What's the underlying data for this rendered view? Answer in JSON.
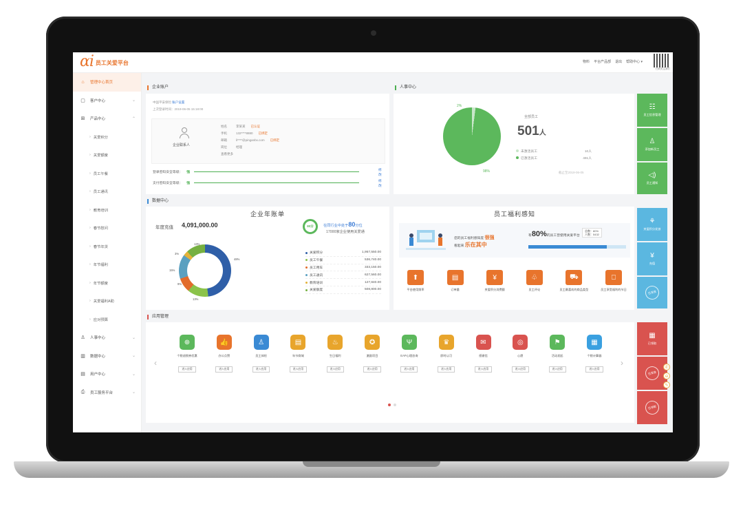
{
  "app": {
    "logo_mark": "αi",
    "logo_text": "员工关爱平台"
  },
  "topbar": {
    "links": [
      "物料",
      "平台产品部",
      "退出",
      "帮助中心 ▾"
    ],
    "qr_caption": "扫码关注我们"
  },
  "sidebar": {
    "items": [
      {
        "label": "管理中心首页",
        "icon": "⌂",
        "active": true
      },
      {
        "label": "客户中心",
        "icon": "▢",
        "chevron": "⌄"
      },
      {
        "label": "产品中心",
        "icon": "⊞",
        "chevron": "⌃"
      }
    ],
    "sub_items": [
      "关爱积分",
      "关爱额度",
      "员工午餐",
      "员工通讯",
      "教育培训",
      "春节慰问",
      "春节年货",
      "年节福利",
      "年节额度",
      "关爱福利A助",
      "应对预算"
    ],
    "bottom_items": [
      {
        "label": "人事中心",
        "icon": "♙",
        "chevron": "⌄"
      },
      {
        "label": "数据中心",
        "icon": "▥",
        "chevron": "⌄"
      },
      {
        "label": "用户中心",
        "icon": "▤",
        "chevron": "⌄"
      },
      {
        "label": "员工服务平台",
        "icon": "⎙",
        "chevron": "⌄"
      }
    ]
  },
  "account": {
    "section_title": "企业账户",
    "meta1": "中国平安保险",
    "meta1_link": "账户设置",
    "meta2": "上次登录时间：2019-06-05 15:18:00",
    "contact_label": "企业联系人",
    "rows": [
      {
        "k": "姓名",
        "v": "李某某",
        "tag": "已认证"
      },
      {
        "k": "手机",
        "v": "132****8880",
        "tag": "已绑定"
      },
      {
        "k": "邮箱",
        "v": "li****@pinganbx.com",
        "tag": "已绑定"
      },
      {
        "k": "岗位",
        "v": "经理",
        "tag": ""
      }
    ],
    "more_link": "查看更多",
    "security": [
      {
        "label": "登录密码安全等级：",
        "level": "强",
        "edit": "修改"
      },
      {
        "label": "支付密码安全等级：",
        "level": "强",
        "edit": "修改"
      }
    ]
  },
  "hr": {
    "section_title": "人事中心",
    "pie_small_label": "2%",
    "pie_large_label": "98%",
    "pie_share_inactive": 0.02,
    "total_label": "全部员工",
    "total_value": "501",
    "total_unit": "人",
    "legend": [
      {
        "label": "未激活员工",
        "value": "10人",
        "color": "#c8e6c9"
      },
      {
        "label": "已激活员工",
        "value": "491人",
        "color": "#5cb85c"
      }
    ],
    "note": "截止至2019-06-05"
  },
  "right_tiles": [
    {
      "label": "员工信息管理",
      "icon": "☷",
      "color": "green"
    },
    {
      "label": "添加新员工",
      "icon": "♙",
      "color": "green"
    },
    {
      "label": "员工通知",
      "icon": "◁)",
      "color": "green"
    },
    {
      "label": "关爱积分发放",
      "icon": "⚘",
      "color": "blue"
    },
    {
      "label": "充值",
      "icon": "¥",
      "color": "blue"
    },
    {
      "label": "已发放",
      "icon": "◎",
      "color": "blue"
    },
    {
      "label": "已领取",
      "icon": "▦",
      "color": "red"
    },
    {
      "label": "已发放",
      "icon": "◎",
      "color": "red"
    },
    {
      "label": "已领取",
      "icon": "◎",
      "color": "red"
    }
  ],
  "data_center": {
    "section_title": "数据中心",
    "bill_title": "企业年账单",
    "annual_label": "年度充值",
    "annual_value": "4,091,000.00",
    "score_badge": "80分",
    "score_text_pre": "在同行业中处于",
    "score_value": "80",
    "score_text_post": "分位",
    "score_sub": "17000家企业使用关爱通",
    "donut_labels": [
      "13%",
      "3%",
      "15%",
      "9%",
      "13%",
      "48%"
    ],
    "bill_items": [
      {
        "name": "关爱积分",
        "value": "1,957,550.00",
        "color": "#2f5fa8"
      },
      {
        "name": "员工午餐",
        "value": "536,740.00",
        "color": "#8bc34a"
      },
      {
        "name": "员工用车",
        "value": "333,150.00",
        "color": "#e26b2b"
      },
      {
        "name": "员工通讯",
        "value": "627,560.00",
        "color": "#5aa0c0"
      },
      {
        "name": "教育培训",
        "value": "127,840.00",
        "color": "#e3b23a"
      },
      {
        "name": "关爱额度",
        "value": "508,800.00",
        "color": "#76b041"
      }
    ]
  },
  "welfare": {
    "title": "员工福利感知",
    "t1_pre": "您的员工福利感知度",
    "t1_strong": "很强",
    "t2_pre": "看起来",
    "t2_strong": "乐在其中",
    "pct_pre": "有",
    "pct_value": "80%",
    "pct_post": "的员工曾使用关爱平台",
    "bar_fraction": 0.8,
    "tip_l1": "总数：80%",
    "tip_l2": "人数：5432",
    "actions": [
      {
        "label": "平台使用频率",
        "icon": "⬆"
      },
      {
        "label": "订单量",
        "icon": "▤"
      },
      {
        "label": "关爱积分消费额",
        "icon": "¥"
      },
      {
        "label": "员工评论",
        "icon": "♧"
      },
      {
        "label": "员工最喜欢的商品类型",
        "icon": "⛟"
      },
      {
        "label": "员工享受福利的节日",
        "icon": "⎕"
      }
    ]
  },
  "apps": {
    "section_title": "应用管理",
    "enter_label": "进入应用",
    "items": [
      {
        "name": "个税退税券优惠",
        "color": "#5cb85c",
        "icon": "⊕"
      },
      {
        "name": "办公点赞",
        "color": "#e8742c",
        "icon": "👍"
      },
      {
        "name": "员工体检",
        "color": "#3a8ad4",
        "icon": "♙"
      },
      {
        "name": "年节商城",
        "color": "#e8a52c",
        "icon": "▤"
      },
      {
        "name": "生日福利",
        "color": "#e8a52c",
        "icon": "♨"
      },
      {
        "name": "激励项目",
        "color": "#e8a52c",
        "icon": "✪"
      },
      {
        "name": "EAP心理咨询",
        "color": "#5cb85c",
        "icon": "Ψ"
      },
      {
        "name": "即时认可",
        "color": "#e8a52c",
        "icon": "♛"
      },
      {
        "name": "感谢信",
        "color": "#d9534f",
        "icon": "✉"
      },
      {
        "name": "心愿",
        "color": "#d9534f",
        "icon": "◎"
      },
      {
        "name": "活动发起",
        "color": "#5cb85c",
        "icon": "⚑"
      },
      {
        "name": "个税计算器",
        "color": "#3aa0e0",
        "icon": "▦"
      }
    ]
  }
}
